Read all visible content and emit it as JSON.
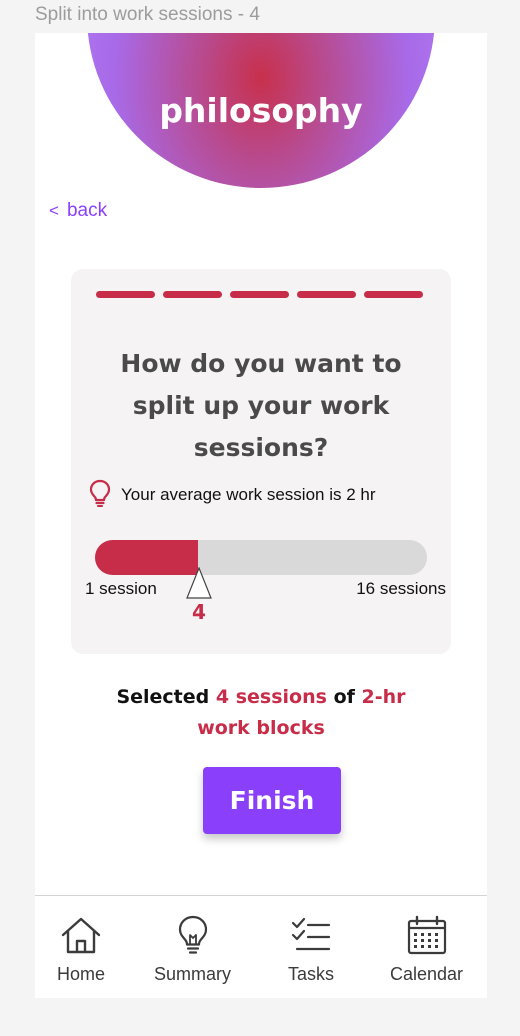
{
  "frame_label": "Split into work sessions - 4",
  "header": {
    "title": "philosophy"
  },
  "back": {
    "chevron": "<",
    "label": "back"
  },
  "card": {
    "progress_steps": 5,
    "question_lines": [
      "How do you want to",
      "split up your work",
      "sessions?"
    ],
    "tip": {
      "icon": "lightbulb-icon",
      "text": "Your average work session is 2 hr"
    },
    "slider": {
      "min_label": "1 session",
      "max_label": "16 sessions",
      "value": "4",
      "fill_fraction": 0.31
    }
  },
  "summary": {
    "prefix": "Selected",
    "sessions": "4 sessions",
    "of": "of",
    "blocks_line1": "2-hr",
    "blocks_line2": "work blocks"
  },
  "finish_label": "Finish",
  "tabs": [
    {
      "label": "Home",
      "icon": "home-icon"
    },
    {
      "label": "Summary",
      "icon": "lightbulb-icon"
    },
    {
      "label": "Tasks",
      "icon": "checklist-icon"
    },
    {
      "label": "Calendar",
      "icon": "calendar-icon"
    }
  ],
  "colors": {
    "accent": "#8a3ffb",
    "brand_red": "#c72c48",
    "track": "#d9d9d9"
  }
}
